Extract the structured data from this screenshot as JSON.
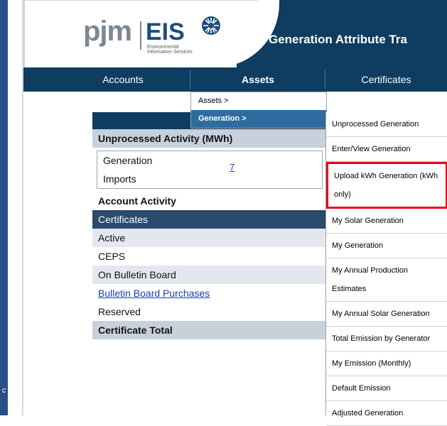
{
  "app": {
    "title": "Generation Attribute Tra",
    "logo": {
      "brand": "pjm",
      "product": "EIS",
      "subtitle_line1": "Environmental",
      "subtitle_line2": "Information Services"
    }
  },
  "leftbar": {
    "label": "c"
  },
  "nav": {
    "items": [
      {
        "label": "Accounts"
      },
      {
        "label": "Assets"
      },
      {
        "label": "Certificates"
      }
    ]
  },
  "assets_menu": {
    "items": [
      {
        "label": "Assets >"
      },
      {
        "label": "Generation >"
      }
    ]
  },
  "generation_menu": {
    "items": [
      {
        "label": "Unprocessed Generation"
      },
      {
        "label": "Enter/View Generation"
      },
      {
        "label": "Upload kWh Generation (kWh only)"
      },
      {
        "label": "My Solar Generation"
      },
      {
        "label": "My Generation"
      },
      {
        "label": "My Annual Production Estimates"
      },
      {
        "label": "My Annual Solar Generation"
      },
      {
        "label": "Total Emission by Generator"
      },
      {
        "label": "My Emission (Monthly)"
      },
      {
        "label": "Default Emission"
      },
      {
        "label": "Adjusted Generation"
      }
    ]
  },
  "panel": {
    "unprocessed_title": "Unprocessed Activity (MWh)",
    "generation": "Generation",
    "generation_value": "7",
    "imports": "Imports",
    "account_activity": "Account Activity",
    "certificates": "Certificates",
    "active": "Active",
    "ceps": "CEPS",
    "bulletin": "On Bulletin Board",
    "bulletin_purchases": "Bulletin Board Purchases",
    "reserved": "Reserved",
    "total": "Certificate Total"
  },
  "colors": {
    "nav_bg": "#0e3d61",
    "highlight_border": "#e8001c",
    "menu_active": "#2e6ca0"
  }
}
